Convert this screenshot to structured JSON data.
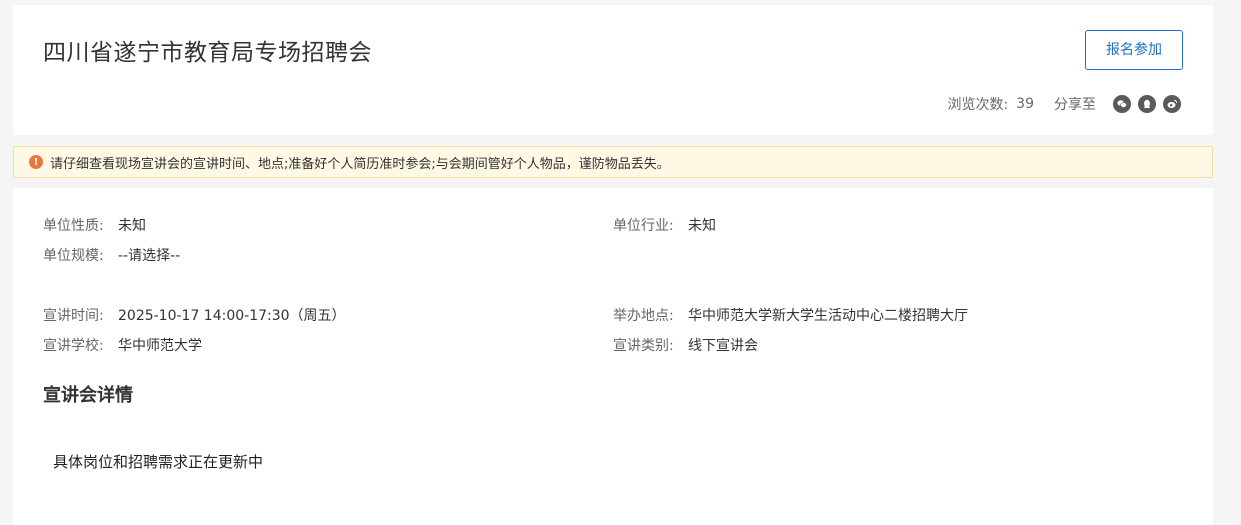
{
  "header": {
    "title": "四川省遂宁市教育局专场招聘会",
    "signup_label": "报名参加",
    "views_label": "浏览次数:",
    "views_count": "39",
    "share_label": "分享至",
    "share_icons": [
      "wechat-icon",
      "qq-icon",
      "weibo-icon"
    ]
  },
  "notice": {
    "icon": "!",
    "text": "请仔细查看现场宣讲会的宣讲时间、地点;准备好个人简历准时参会;与会期间管好个人物品，谨防物品丢失。"
  },
  "company": {
    "nature_label": "单位性质:",
    "nature_value": "未知",
    "industry_label": "单位行业:",
    "industry_value": "未知",
    "scale_label": "单位规模:",
    "scale_value": "--请选择--"
  },
  "event": {
    "time_label": "宣讲时间:",
    "time_value": "2025-10-17 14:00-17:30（周五）",
    "place_label": "举办地点:",
    "place_value": "华中师范大学新大学生活动中心二楼招聘大厅",
    "school_label": "宣讲学校:",
    "school_value": "华中师范大学",
    "type_label": "宣讲类别:",
    "type_value": "线下宣讲会"
  },
  "details": {
    "title": "宣讲会详情",
    "text": "具体岗位和招聘需求正在更新中"
  },
  "colors": {
    "accent": "#1e6fc5",
    "notice_bg": "#fff8e4",
    "warn": "#f0743c"
  }
}
